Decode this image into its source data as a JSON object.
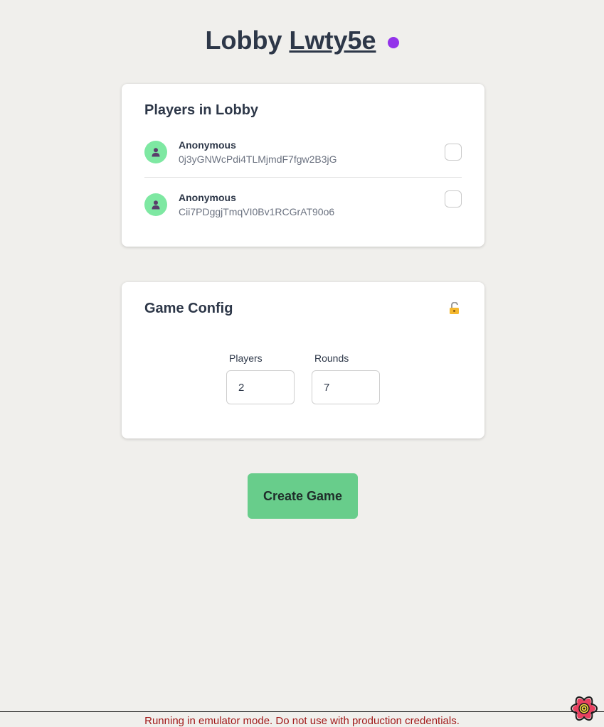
{
  "lobby": {
    "title_prefix": "Lobby",
    "code": "Lwty5e",
    "status_color": "#9333ea"
  },
  "players_card": {
    "title": "Players in Lobby",
    "players": [
      {
        "name": "Anonymous",
        "id": "0j3yGNWcPdi4TLMjmdF7fgw2B3jG",
        "checked": false
      },
      {
        "name": "Anonymous",
        "id": "Cii7PDggjTmqVI0Bv1RCGrAT90o6",
        "checked": false
      }
    ]
  },
  "config_card": {
    "title": "Game Config",
    "lock_icon": "unlocked-lock-icon",
    "players_label": "Players",
    "players_value": "2",
    "rounds_label": "Rounds",
    "rounds_value": "7"
  },
  "actions": {
    "create_label": "Create Game",
    "create_color": "#68cd8b"
  },
  "footer": {
    "warning": "Running in emulator mode. Do not use with production credentials.",
    "icon": "emulator-atom-icon"
  }
}
